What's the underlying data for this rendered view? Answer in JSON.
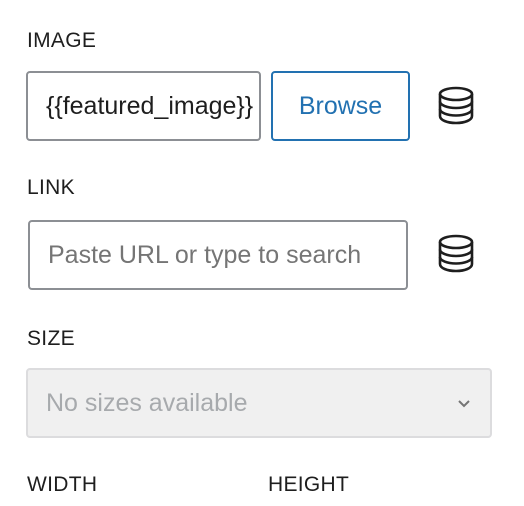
{
  "image": {
    "label": "IMAGE",
    "value": "{{featured_image}}",
    "browse_label": "Browse",
    "dynamic_icon": "database-icon"
  },
  "link": {
    "label": "LINK",
    "value": "",
    "placeholder": "Paste URL or type to search",
    "dynamic_icon": "database-icon"
  },
  "size": {
    "label": "SIZE",
    "selected": "No sizes available",
    "disabled": true
  },
  "dimensions": {
    "width_label": "WIDTH",
    "height_label": "HEIGHT"
  },
  "colors": {
    "accent": "#2271b1",
    "border": "#8c8f94",
    "disabled_bg": "#f0f0f0",
    "disabled_text": "#a7aaad"
  }
}
